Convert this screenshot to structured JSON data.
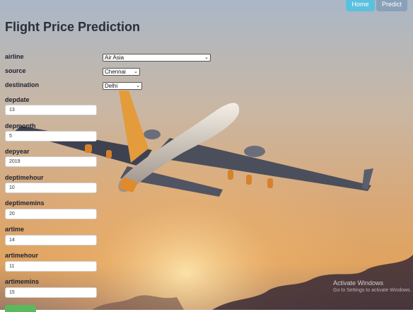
{
  "nav": {
    "home": "Home",
    "predict": "Predict"
  },
  "title": "Flight Price Prediction",
  "fields": {
    "airline": {
      "label": "airline",
      "value": "Air Asia"
    },
    "source": {
      "label": "source",
      "value": "Chennai"
    },
    "destination": {
      "label": "destination",
      "value": "Delhi"
    },
    "depdate": {
      "label": "depdate",
      "value": "13"
    },
    "depmonth": {
      "label": "depmonth",
      "value": "5"
    },
    "depyear": {
      "label": "depyear",
      "value": "2019"
    },
    "deptimehour": {
      "label": "deptimehour",
      "value": "10"
    },
    "deptimemins": {
      "label": "deptimemins",
      "value": "20"
    },
    "artime": {
      "label": "artime",
      "value": "14"
    },
    "artimehour": {
      "label": "artimehour",
      "value": "11"
    },
    "artimemins": {
      "label": "artimemins",
      "value": "15"
    }
  },
  "watermark": {
    "line1": "Activate Windows",
    "line2": "Go to Settings to activate Windows."
  }
}
